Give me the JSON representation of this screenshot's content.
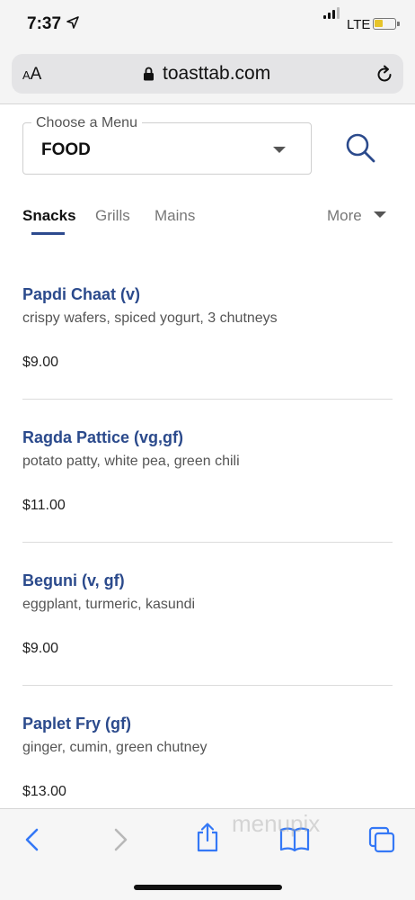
{
  "status_bar": {
    "time": "7:37",
    "network": "LTE",
    "battery_color": "#e6c42a"
  },
  "browser": {
    "text_size_small": "A",
    "text_size_large": "A",
    "url": "toasttab.com"
  },
  "menu_selector": {
    "label": "Choose a Menu",
    "value": "FOOD"
  },
  "tabs": [
    {
      "label": "Snacks",
      "active": true
    },
    {
      "label": "Grills",
      "active": false
    },
    {
      "label": "Mains",
      "active": false
    }
  ],
  "more_label": "More",
  "items": [
    {
      "name": "Papdi Chaat (v)",
      "description": "crispy wafers, spiced yogurt, 3 chutneys",
      "price": "$9.00"
    },
    {
      "name": "Ragda Pattice (vg,gf)",
      "description": "potato patty, white pea, green chili",
      "price": "$11.00"
    },
    {
      "name": "Beguni (v, gf)",
      "description": "eggplant, turmeric, kasundi",
      "price": "$9.00"
    },
    {
      "name": "Paplet Fry (gf)",
      "description": "ginger, cumin, green chutney",
      "price": "$13.00"
    }
  ],
  "watermark": "menupix",
  "colors": {
    "accent": "#2b4a8c",
    "toolbar_icon": "#3478f6"
  },
  "icons": {
    "location": "location-arrow-icon",
    "signal": "signal-icon",
    "battery": "battery-icon",
    "lock": "lock-icon",
    "reload": "reload-icon",
    "search": "search-icon",
    "back": "back-icon",
    "forward": "forward-icon",
    "share": "share-icon",
    "bookmarks": "bookmarks-icon",
    "tabs": "tabs-icon"
  }
}
